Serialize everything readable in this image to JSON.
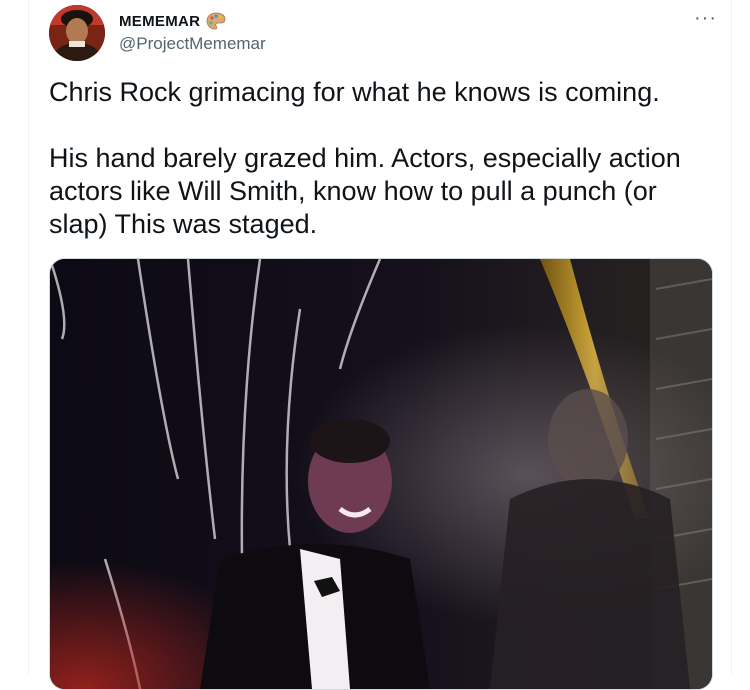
{
  "tweet": {
    "display_name": "MEMEMAR",
    "handle": "@ProjectMememar",
    "more_label": "···",
    "text_paragraphs": [
      "Chris Rock grimacing for what he knows is coming.",
      "His hand barely grazed him. Actors, especially action actors like Will Smith, know how to pull a punch (or slap) This was staged."
    ],
    "media_type": "video-still"
  },
  "icons": {
    "avatar": "profile-photo",
    "name_emoji": "artist-palette-icon",
    "more": "more-horizontal-icon"
  },
  "colors": {
    "text": "#0f1419",
    "secondary": "#536471",
    "border": "#cfd9de"
  }
}
